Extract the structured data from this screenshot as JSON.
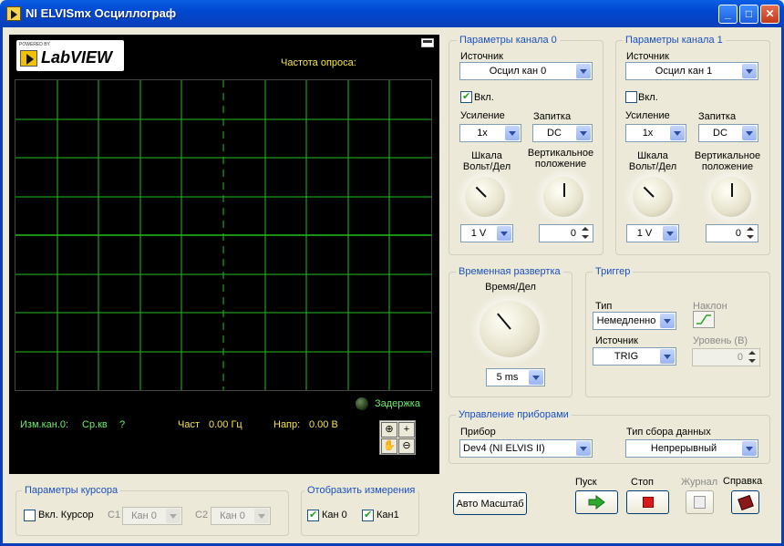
{
  "window": {
    "title": "NI ELVISmx Осциллограф",
    "minimize": "_",
    "maximize": "□",
    "close": "✕"
  },
  "plot": {
    "logo": {
      "tag": "POWERED BY",
      "text": "LabVIEW"
    },
    "sample_rate_label": "Частота опроса:",
    "delay_label": "Задержка",
    "measure": {
      "channel": "Изм.кан.0:",
      "rms_label": "Ср.кв",
      "rms_value": "?",
      "freq_label": "Част",
      "freq_value": "0.00 Гц",
      "volt_label": "Напр:",
      "volt_value": "0.00 В"
    },
    "colors": {
      "grid": "#1fbf1f",
      "trace": "#1fbf1f",
      "background": "#000000"
    }
  },
  "ch0": {
    "title": "Параметры канала 0",
    "source_label": "Источник",
    "source_value": "Осцил кан 0",
    "enable_label": "Вкл.",
    "enabled": true,
    "gain_label": "Усиление",
    "gain_value": "1x",
    "coupling_label": "Запитка",
    "coupling_value": "DC",
    "scale_label": "Шкала Вольт/Дел",
    "scale_value": "1 V",
    "vpos_label": "Вертикальное положение",
    "vpos_value": "0"
  },
  "ch1": {
    "title": "Параметры канала 1",
    "source_label": "Источник",
    "source_value": "Осцил кан 1",
    "enable_label": "Вкл.",
    "enabled": false,
    "gain_label": "Усиление",
    "gain_value": "1x",
    "coupling_label": "Запитка",
    "coupling_value": "DC",
    "scale_label": "Шкала Вольт/Дел",
    "scale_value": "1 V",
    "vpos_label": "Вертикальное положение",
    "vpos_value": "0"
  },
  "timebase": {
    "title": "Временная развертка",
    "label": "Время/Дел",
    "value": "5 ms"
  },
  "trigger": {
    "title": "Триггер",
    "type_label": "Тип",
    "type_value": "Немедленно",
    "slope_label": "Наклон",
    "source_label": "Источник",
    "source_value": "TRIG",
    "level_label": "Уровень (В)",
    "level_value": "0"
  },
  "instrument": {
    "title": "Управление приборами",
    "device_label": "Прибор",
    "device_value": "Dev4 (NI ELVIS II)",
    "acq_label": "Тип сбора данных",
    "acq_value": "Непрерывный"
  },
  "cursor": {
    "title": "Параметры курсора",
    "enable_label": "Вкл. Курсор",
    "c1_label": "C1",
    "c1_value": "Кан 0",
    "c2_label": "C2",
    "c2_value": "Кан 0"
  },
  "display": {
    "title": "Отобразить измерения",
    "ch0_label": "Кан 0",
    "ch1_label": "Кан1"
  },
  "buttons": {
    "autoscale": "Авто Масштаб",
    "run_label": "Пуск",
    "stop_label": "Стоп",
    "log_label": "Журнал",
    "help_label": "Справка"
  }
}
